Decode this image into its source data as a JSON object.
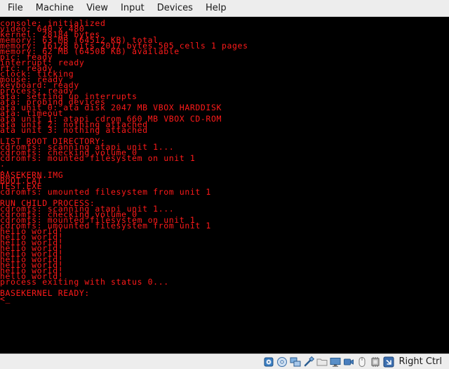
{
  "menu": {
    "items": [
      "File",
      "Machine",
      "View",
      "Input",
      "Devices",
      "Help"
    ]
  },
  "console": {
    "lines": [
      "console: initialized",
      "video: 640 x 480",
      "kernel: 28184 bytes",
      "memory: 63 MB (64512 KB) total",
      "memory: 16128 bits 2017 bytes 505 cells 1 pages",
      "memory: 62 MB (64508 KB) available",
      "pic: ready",
      "interrupt: ready",
      "rtc: ready",
      "clock: ticking",
      "mouse: ready",
      "keyboard: ready",
      "process: ready",
      "ata: setting up interrupts",
      "ata: probing devices",
      "ata unit 0: ata disk 2047 MB VBOX HARDDISK",
      "ata: timeout",
      "ata unit 1: atapi cdrom 660 MB VBOX CD-ROM",
      "ata unit 2: nothing attached",
      "ata unit 3: nothing attached",
      "",
      "LIST ROOT DIRECTORY:",
      "cdromfs: scanning atapi unit 1...",
      "cdromfs: checking volume 0",
      "cdromfs: mounted filesystem on unit 1",
      ".",
      "..",
      "BASEKERN.IMG",
      "BOOT.CAT",
      "TEST.EXE",
      "cdromfs: umounted filesystem from unit 1",
      "",
      "RUN CHILD PROCESS:",
      "cdromfs: scanning atapi unit 1...",
      "cdromfs: checking volume 0",
      "cdromfs: mounted filesystem on unit 1",
      "cdromfs: umounted filesystem from unit 1",
      "hello world!",
      "hello world!",
      "hello world!",
      "hello world!",
      "hello world!",
      "hello world!",
      "hello world!",
      "hello world!",
      "hello world!",
      "process exiting with status 0...",
      "",
      "BASEKERNEL READY:",
      "<_"
    ],
    "text_color": "#ff1a1a",
    "background_color": "#000000"
  },
  "statusbar": {
    "icons": [
      "hard-disk-icon",
      "optical-drive-icon",
      "network-icon",
      "usb-icon",
      "shared-folders-icon",
      "display-icon",
      "video-capture-icon",
      "mouse-integration-icon",
      "cpu-icon",
      "keyboard-capture-icon"
    ],
    "host_key_label": "Right Ctrl"
  }
}
